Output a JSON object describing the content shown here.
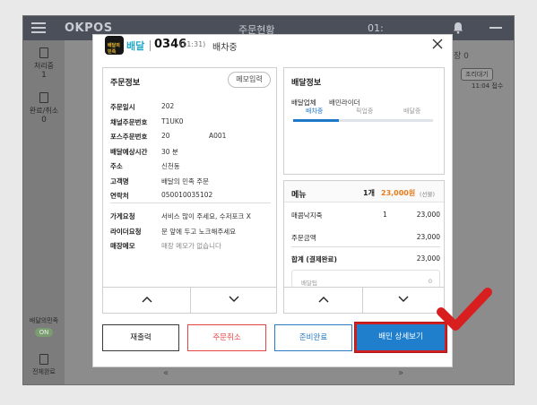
{
  "app": {
    "logo": "OKPOS",
    "header_title": "주문현황",
    "header_time": "01:",
    "colors": {
      "accent": "#1f7fcc",
      "brand": "#22a8c8",
      "danger": "#e64545",
      "amount": "#e87b1c",
      "highlight": "#d11f1f"
    }
  },
  "rail": {
    "processing_label": "처리중",
    "processing_count": "1",
    "done_label": "완료/취소",
    "done_count": "0",
    "baemin_label": "배달의민족",
    "baemin_toggle": "ON",
    "all_done_label": "전체완료"
  },
  "background": {
    "tab_fragment": "장 0",
    "cook_wait_badge": "조리대기",
    "received_time": "11:04 접수"
  },
  "modal": {
    "brand_icon_text": "배달의민족",
    "brand_label": "배달",
    "order_no": "0346",
    "order_time": "(11:31)",
    "order_status": "배차중",
    "close_icon": "close-icon",
    "order_info": {
      "title": "주문정보",
      "memo_button": "메모입력",
      "rows": [
        {
          "key": "주문일시",
          "value": "202",
          "extra": ""
        },
        {
          "key": "채널주문번호",
          "value": "T1UK0",
          "extra": ""
        },
        {
          "key": "포스주문번호",
          "value": "20",
          "extra": "A001"
        },
        {
          "key": "배달예상시간",
          "value": "30 분",
          "extra": ""
        },
        {
          "key": "주소",
          "value": "신천동",
          "extra": ""
        },
        {
          "key": "고객명",
          "value": "배달의 민족 주문",
          "extra": ""
        },
        {
          "key": "연락처",
          "value": "050010035102",
          "extra": ""
        }
      ],
      "requests": [
        {
          "key": "가게요청",
          "value": "서비스 많이 주세요, 수저포크 X"
        },
        {
          "key": "라이더요청",
          "value": "문 앞에 두고 노크해주세요"
        },
        {
          "key": "매장메모",
          "value": "매장 메모가 없습니다"
        }
      ]
    },
    "delivery_info": {
      "title": "배달정보",
      "company_label": "배달업체",
      "company_value": "배민라이더",
      "steps": [
        "배차중",
        "픽업중",
        "배달중"
      ],
      "active_step": 0,
      "progress_fraction": 0.33
    },
    "menu": {
      "title": "메뉴",
      "count": "1개",
      "total": "23,000원",
      "paid_note": "(선불)",
      "items": [
        {
          "name": "매콤낙지죽",
          "qty": "1",
          "price": "23,000"
        }
      ],
      "order_amount_label": "주문금액",
      "order_amount": "23,000",
      "sum_label": "합계 (결제완료)",
      "sum": "23,000",
      "payment_label": "배달팁",
      "payment_value": "0"
    },
    "buttons": {
      "reprint": "재출력",
      "cancel": "주문취소",
      "ready": "준비완료",
      "detail": "배민 상세보기"
    }
  }
}
